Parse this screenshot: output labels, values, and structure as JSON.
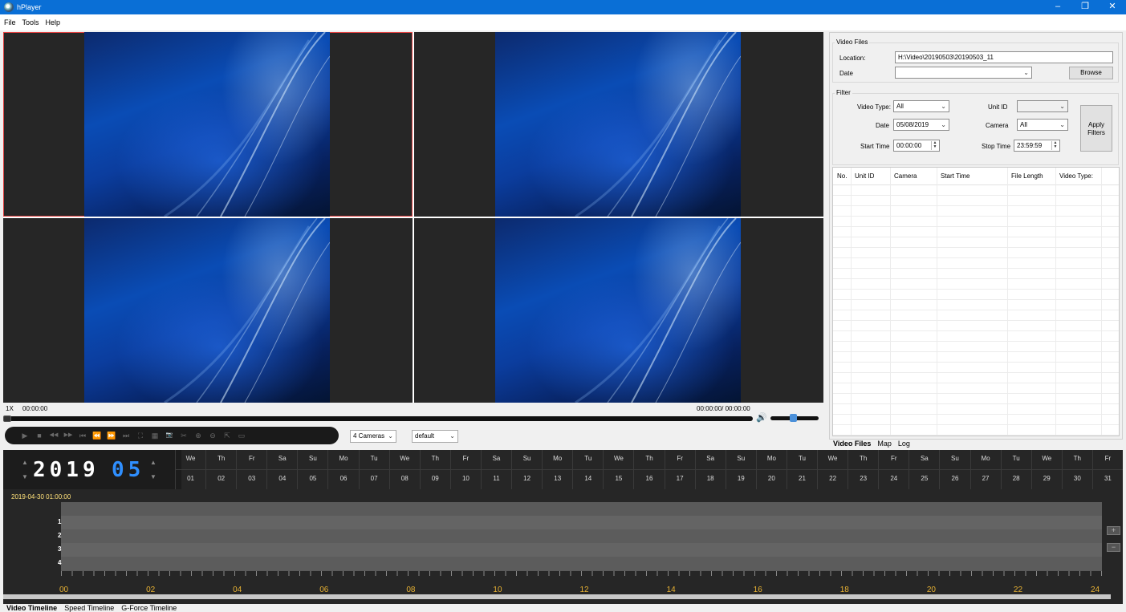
{
  "window": {
    "title": "hPlayer",
    "controls": [
      "–",
      "❐",
      "✕"
    ]
  },
  "menu": [
    "File",
    "Tools",
    "Help"
  ],
  "playback": {
    "speed": "1X",
    "current_time": "00:00:00",
    "time_display": "00:00:00/ 00:00:00",
    "layout_select": "4 Cameras",
    "profile_select": "default"
  },
  "control_icons": [
    "play-icon",
    "stop-icon",
    "rewind-icon",
    "fast-forward-icon",
    "prev-frame-icon",
    "step-back-icon",
    "step-forward-icon",
    "next-frame-icon",
    "fullscreen-icon",
    "grid-icon",
    "snapshot-icon",
    "clip-icon",
    "zoom-in-icon",
    "zoom-out-icon",
    "export-icon",
    "window-icon"
  ],
  "video_files": {
    "group_label": "Video Files",
    "location_label": "Location:",
    "location_value": "H:\\Video\\20190503\\20190503_11",
    "date_label": "Date",
    "date_value": "",
    "browse_label": "Browse"
  },
  "filter": {
    "group_label": "Filter",
    "video_type_label": "Video Type:",
    "video_type_value": "All",
    "unit_id_label": "Unit ID",
    "unit_id_value": "",
    "date_label": "Date",
    "date_value": "05/08/2019",
    "camera_label": "Camera",
    "camera_value": "All",
    "start_time_label": "Start Time",
    "start_time_value": "00:00:00",
    "stop_time_label": "Stop Time",
    "stop_time_value": "23:59:59",
    "apply_label_1": "Apply",
    "apply_label_2": "Filters"
  },
  "file_table": {
    "columns": [
      "No.",
      "Unit ID",
      "Camera",
      "Start Time",
      "File Length",
      "Video Type:"
    ]
  },
  "side_tabs": [
    "Video Files",
    "Map",
    "Log"
  ],
  "calendar": {
    "year": "2019",
    "month": "05",
    "weekdays": [
      "We",
      "Th",
      "Fr",
      "Sa",
      "Su",
      "Mo",
      "Tu",
      "We",
      "Th",
      "Fr",
      "Sa",
      "Su",
      "Mo",
      "Tu",
      "We",
      "Th",
      "Fr",
      "Sa",
      "Su",
      "Mo",
      "Tu",
      "We",
      "Th",
      "Fr",
      "Sa",
      "Su",
      "Mo",
      "Tu",
      "We",
      "Th",
      "Fr"
    ],
    "days": [
      "01",
      "02",
      "03",
      "04",
      "05",
      "06",
      "07",
      "08",
      "09",
      "10",
      "11",
      "12",
      "13",
      "14",
      "15",
      "16",
      "17",
      "18",
      "19",
      "20",
      "21",
      "22",
      "23",
      "24",
      "25",
      "26",
      "27",
      "28",
      "29",
      "30",
      "31"
    ]
  },
  "timeline": {
    "timestamp": "2019-04-30 01:00:00",
    "tracks": [
      "1",
      "2",
      "3",
      "4"
    ],
    "hours": [
      "00",
      "02",
      "04",
      "06",
      "08",
      "10",
      "12",
      "14",
      "16",
      "18",
      "20",
      "22",
      "24"
    ],
    "zoom_in": "+",
    "zoom_out": "−"
  },
  "bottom_tabs": [
    "Video Timeline",
    "Speed Timeline",
    "G-Force Timeline"
  ],
  "colors": {
    "titlebar": "#0a6fd6",
    "digit_year": "#ffffff",
    "digit_month": "#2f8fff",
    "timestamp": "#ffe17a",
    "hour_label": "#e8b233"
  }
}
